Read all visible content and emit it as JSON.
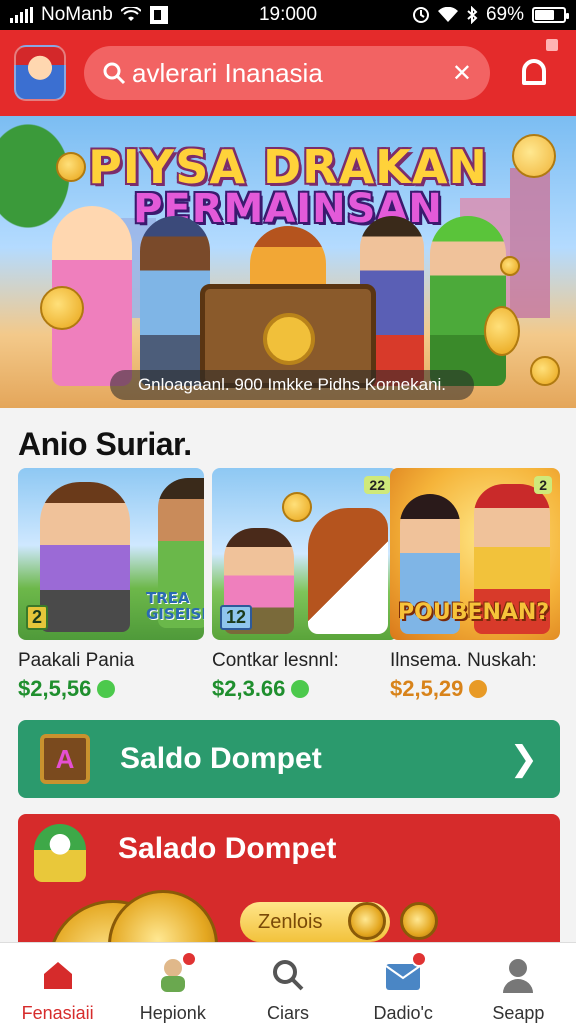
{
  "status_bar": {
    "carrier": "NoManb",
    "time": "19:000",
    "battery": "69%",
    "battery_level": 0.69
  },
  "header": {
    "search_text": "avlerari Inanasia",
    "clear_icon": "close-icon",
    "bell_icon": "bell-icon"
  },
  "banner": {
    "title_line1": "PIYSA DRAKAN",
    "title_line2": "PERMAINSAN",
    "caption": "Gnloagaanl. 900 Imkke Pidhs Kornekani."
  },
  "section": {
    "title": "Anio Suriar."
  },
  "cards": [
    {
      "name": "Paakali Pania",
      "price": "$2,5,56",
      "price_color": "#1f8f2e",
      "dot_color": "#4cc94c",
      "badge": "2",
      "overlay": "TREA GISEISES"
    },
    {
      "name": "Contkar lesnnl:",
      "price": "$2,3.66",
      "price_color": "#1f8f2e",
      "dot_color": "#4cc94c",
      "badge": "12",
      "tag": "22"
    },
    {
      "name": "Ilnsema. Nuskah:",
      "price": "$2,5,29",
      "price_color": "#d8831a",
      "dot_color": "#e89a25",
      "tag": "2",
      "overlay": "POUBENAN?"
    }
  ],
  "wallet_primary": {
    "label": "Saldo Dompet",
    "icon_letter": "A"
  },
  "wallet_secondary": {
    "label": "Salado Dompet",
    "pill": "Zenlois"
  },
  "nav": [
    {
      "label": "Fenasiaii",
      "icon": "home-icon",
      "active": true
    },
    {
      "label": "Hepionk",
      "icon": "character-icon",
      "active": false
    },
    {
      "label": "Ciars",
      "icon": "search-icon",
      "active": false
    },
    {
      "label": "Dadio'c",
      "icon": "mail-icon",
      "active": false
    },
    {
      "label": "Seapp",
      "icon": "profile-icon",
      "active": false
    }
  ],
  "colors": {
    "header_red": "#e42b2b",
    "wallet_green": "#2b9a6d",
    "wallet_red": "#d62b2b",
    "active_nav": "#d62b2b"
  }
}
